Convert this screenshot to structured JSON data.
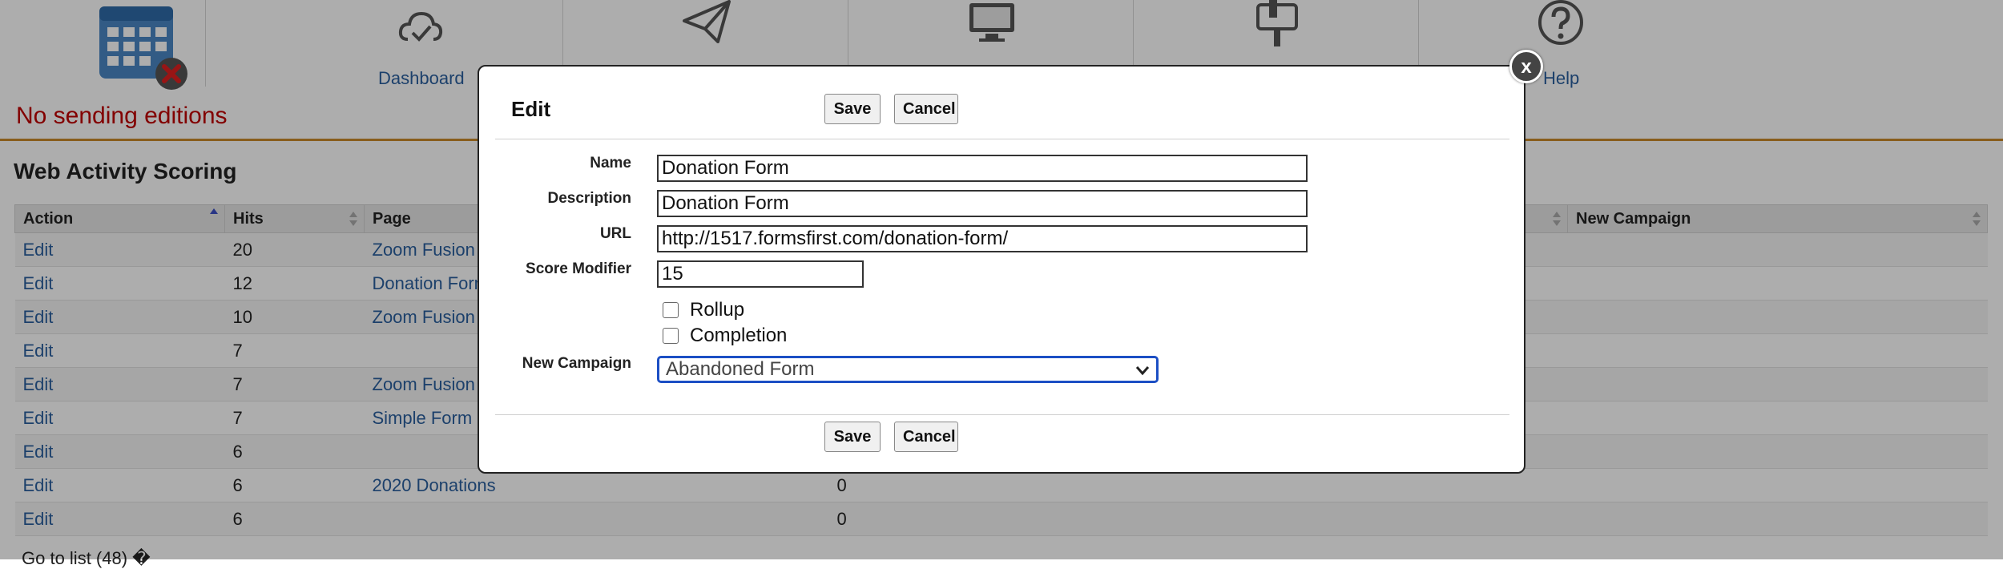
{
  "nav": {
    "status": "No sending editions",
    "items": [
      {
        "icon": "calendar-icon",
        "label": ""
      },
      {
        "icon": "cloud-check-icon",
        "label": "Dashboard"
      },
      {
        "icon": "paper-plane-icon",
        "label": ""
      },
      {
        "icon": "monitor-icon",
        "label": ""
      },
      {
        "icon": "mailbox-icon",
        "label": ""
      },
      {
        "icon": "help-icon",
        "label": "Help"
      }
    ]
  },
  "section_title": "Web Activity Scoring",
  "table": {
    "headers": [
      "Action",
      "Hits",
      "Page",
      "",
      "New Campaign"
    ],
    "rows": [
      {
        "action": "Edit",
        "hits": "20",
        "page": "Zoom Fusion",
        "score": ""
      },
      {
        "action": "Edit",
        "hits": "12",
        "page": "Donation Form",
        "score": ""
      },
      {
        "action": "Edit",
        "hits": "10",
        "page": "Zoom Fusion",
        "score": ""
      },
      {
        "action": "Edit",
        "hits": "7",
        "page": "",
        "score": ""
      },
      {
        "action": "Edit",
        "hits": "7",
        "page": "Zoom Fusion",
        "score": ""
      },
      {
        "action": "Edit",
        "hits": "7",
        "page": "Simple Form",
        "score": ""
      },
      {
        "action": "Edit",
        "hits": "6",
        "page": "",
        "score": ""
      },
      {
        "action": "Edit",
        "hits": "6",
        "page": "2020 Donations",
        "score": "0"
      },
      {
        "action": "Edit",
        "hits": "6",
        "page": "",
        "score": "0"
      }
    ]
  },
  "footer": {
    "go_to_list": "Go to list (48) �"
  },
  "dialog": {
    "title": "Edit",
    "save_label": "Save",
    "cancel_label": "Cancel",
    "close_label": "x",
    "fields": {
      "name": {
        "label": "Name",
        "value": "Donation Form"
      },
      "description": {
        "label": "Description",
        "value": "Donation Form"
      },
      "url": {
        "label": "URL",
        "value": "http://1517.formsfirst.com/donation-form/"
      },
      "score_modifier": {
        "label": "Score Modifier",
        "value": "15"
      },
      "rollup": {
        "label": "Rollup",
        "checked": false
      },
      "completion": {
        "label": "Completion",
        "checked": false
      },
      "new_campaign": {
        "label": "New Campaign",
        "value": "Abandoned Form"
      }
    }
  },
  "colors": {
    "accent": "#2a5f9e",
    "status": "#c00000",
    "focus": "#1c4fc4",
    "rule": "#c98a2a"
  }
}
